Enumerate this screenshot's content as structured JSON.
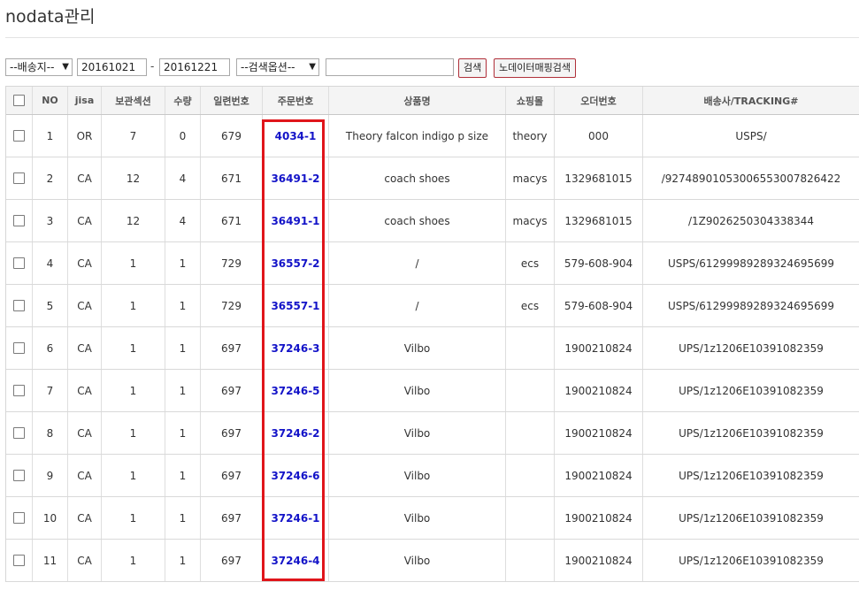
{
  "page": {
    "title": "nodata관리"
  },
  "filters": {
    "delivery_select": "--배송지--",
    "date_from": "20161021",
    "date_separator": "-",
    "date_to": "20161221",
    "search_option_select": "--검색옵션--",
    "keyword": "",
    "search_button": "검색",
    "nodata_mapping_button": "노데이터매핑검색"
  },
  "table": {
    "columns": [
      "NO",
      "jisa",
      "보관섹션",
      "수량",
      "일련번호",
      "주문번호",
      "상품명",
      "쇼핑몰",
      "오더번호",
      "배송사/TRACKING#"
    ],
    "rows": [
      {
        "no": "1",
        "jisa": "OR",
        "section": "7",
        "qty": "0",
        "serial": "679",
        "order_no": "4034-1",
        "product": "Theory falcon indigo p size",
        "mall": "theory",
        "order_id": "000",
        "tracking": "USPS/"
      },
      {
        "no": "2",
        "jisa": "CA",
        "section": "12",
        "qty": "4",
        "serial": "671",
        "order_no": "36491-2",
        "product": "coach shoes",
        "mall": "macys",
        "order_id": "1329681015",
        "tracking": "/9274890105300655300782​6422"
      },
      {
        "no": "3",
        "jisa": "CA",
        "section": "12",
        "qty": "4",
        "serial": "671",
        "order_no": "36491-1",
        "product": "coach shoes",
        "mall": "macys",
        "order_id": "1329681015",
        "tracking": "/1Z9026250304338344"
      },
      {
        "no": "4",
        "jisa": "CA",
        "section": "1",
        "qty": "1",
        "serial": "729",
        "order_no": "36557-2",
        "product": "/",
        "mall": "ecs",
        "order_id": "579-608-904",
        "tracking": "USPS/61299989289324695699"
      },
      {
        "no": "5",
        "jisa": "CA",
        "section": "1",
        "qty": "1",
        "serial": "729",
        "order_no": "36557-1",
        "product": "/",
        "mall": "ecs",
        "order_id": "579-608-904",
        "tracking": "USPS/61299989289324695699"
      },
      {
        "no": "6",
        "jisa": "CA",
        "section": "1",
        "qty": "1",
        "serial": "697",
        "order_no": "37246-3",
        "product": "Vilbo",
        "mall": "",
        "order_id": "1900210824",
        "tracking": "UPS/1z1206E10391082359"
      },
      {
        "no": "7",
        "jisa": "CA",
        "section": "1",
        "qty": "1",
        "serial": "697",
        "order_no": "37246-5",
        "product": "Vilbo",
        "mall": "",
        "order_id": "1900210824",
        "tracking": "UPS/1z1206E10391082359"
      },
      {
        "no": "8",
        "jisa": "CA",
        "section": "1",
        "qty": "1",
        "serial": "697",
        "order_no": "37246-2",
        "product": "Vilbo",
        "mall": "",
        "order_id": "1900210824",
        "tracking": "UPS/1z1206E10391082359"
      },
      {
        "no": "9",
        "jisa": "CA",
        "section": "1",
        "qty": "1",
        "serial": "697",
        "order_no": "37246-6",
        "product": "Vilbo",
        "mall": "",
        "order_id": "1900210824",
        "tracking": "UPS/1z1206E10391082359"
      },
      {
        "no": "10",
        "jisa": "CA",
        "section": "1",
        "qty": "1",
        "serial": "697",
        "order_no": "37246-1",
        "product": "Vilbo",
        "mall": "",
        "order_id": "1900210824",
        "tracking": "UPS/1z1206E10391082359"
      },
      {
        "no": "11",
        "jisa": "CA",
        "section": "1",
        "qty": "1",
        "serial": "697",
        "order_no": "37246-4",
        "product": "Vilbo",
        "mall": "",
        "order_id": "1900210824",
        "tracking": "UPS/1z1206E10391082359"
      }
    ]
  },
  "colors": {
    "order_link": "#1313c8",
    "highlight_border": "#e0151b",
    "button_border": "#b0303a"
  }
}
